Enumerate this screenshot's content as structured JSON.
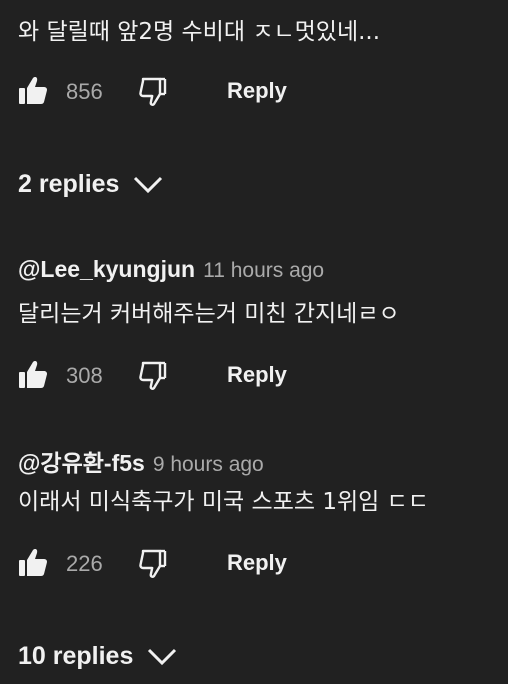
{
  "top_comment": {
    "text": "와 달릴때 앞2명 수비대 ㅈㄴ멋있네...",
    "likes": "856",
    "reply_label": "Reply"
  },
  "replies_toggle_1": {
    "label": "2 replies"
  },
  "reply_1": {
    "author": "@Lee_kyungjun",
    "time": "11 hours ago",
    "text": "달리는거 커버해주는거 미친 간지네ㄹㅇ",
    "likes": "308",
    "reply_label": "Reply"
  },
  "reply_2": {
    "author": "@강유환-f5s",
    "time": "9 hours ago",
    "text": "이래서 미식축구가 미국 스포츠 1위임 ㄷㄷ",
    "likes": "226",
    "reply_label": "Reply"
  },
  "replies_toggle_2": {
    "label": "10 replies"
  },
  "icons": {
    "like": "thumbs-up-icon",
    "dislike": "thumbs-down-icon",
    "expand": "chevron-down-icon"
  },
  "colors": {
    "background": "#212121",
    "text_primary": "#f1f1f1",
    "text_secondary": "#aaaaaa"
  }
}
